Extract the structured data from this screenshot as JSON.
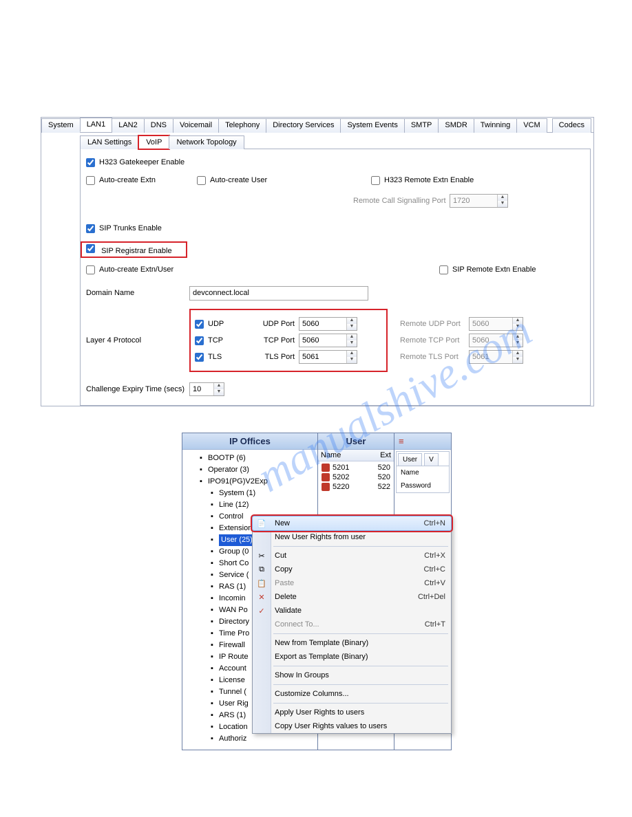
{
  "tabs_outer": [
    "System",
    "LAN1",
    "LAN2",
    "DNS",
    "Voicemail",
    "Telephony",
    "Directory Services",
    "System Events",
    "SMTP",
    "SMDR",
    "Twinning",
    "VCM",
    "Codecs"
  ],
  "tabs_outer_active": "LAN1",
  "tabs_inner": [
    "LAN Settings",
    "VoIP",
    "Network Topology"
  ],
  "tabs_inner_active": "VoIP",
  "form": {
    "h323_gatekeeper": "H323 Gatekeeper Enable",
    "auto_create_extn": "Auto-create Extn",
    "auto_create_user": "Auto-create User",
    "h323_remote": "H323 Remote Extn Enable",
    "remote_call_port_label": "Remote Call Signalling Port",
    "remote_call_port": "1720",
    "sip_trunks": "SIP Trunks Enable",
    "sip_registrar": "SIP Registrar Enable",
    "auto_create_extn_user": "Auto-create Extn/User",
    "sip_remote": "SIP Remote Extn Enable",
    "domain_label": "Domain Name",
    "domain_value": "devconnect.local",
    "layer4_label": "Layer 4 Protocol",
    "udp": "UDP",
    "udp_port_label": "UDP Port",
    "udp_port": "5060",
    "tcp": "TCP",
    "tcp_port_label": "TCP Port",
    "tcp_port": "5060",
    "tls": "TLS",
    "tls_port_label": "TLS Port",
    "tls_port": "5061",
    "remote_udp_label": "Remote UDP Port",
    "remote_udp": "5060",
    "remote_tcp_label": "Remote TCP Port",
    "remote_tcp": "5060",
    "remote_tls_label": "Remote TLS Port",
    "remote_tls": "5061",
    "challenge_label": "Challenge Expiry Time (secs)",
    "challenge_value": "10"
  },
  "panel2": {
    "tree_header": "IP Offices",
    "user_header": "User",
    "tree": [
      {
        "label": "BOOTP (6)",
        "indent": 0
      },
      {
        "label": "Operator (3)",
        "indent": 0
      },
      {
        "label": "IPO91(PG)V2Exp",
        "indent": 0
      },
      {
        "label": "System (1)",
        "indent": 1
      },
      {
        "label": "Line (12)",
        "indent": 1
      },
      {
        "label": "Control",
        "indent": 1
      },
      {
        "label": "Extension",
        "indent": 1
      },
      {
        "label": "User (25)",
        "indent": 1,
        "selected": true
      },
      {
        "label": "Group (0",
        "indent": 1
      },
      {
        "label": "Short Co",
        "indent": 1
      },
      {
        "label": "Service (",
        "indent": 1
      },
      {
        "label": "RAS (1)",
        "indent": 1
      },
      {
        "label": "Incomin",
        "indent": 1
      },
      {
        "label": "WAN Po",
        "indent": 1
      },
      {
        "label": "Directory",
        "indent": 1
      },
      {
        "label": "Time Pro",
        "indent": 1
      },
      {
        "label": "Firewall ",
        "indent": 1
      },
      {
        "label": "IP Route",
        "indent": 1
      },
      {
        "label": "Account",
        "indent": 1
      },
      {
        "label": "License ",
        "indent": 1
      },
      {
        "label": "Tunnel (",
        "indent": 1
      },
      {
        "label": "User Rig",
        "indent": 1
      },
      {
        "label": "ARS (1)",
        "indent": 1
      },
      {
        "label": "Location",
        "indent": 1
      },
      {
        "label": "Authoriz",
        "indent": 1
      }
    ],
    "user_cols": {
      "c1": "Name",
      "c2": "Ext"
    },
    "users": [
      {
        "name": "5201",
        "ext": "520"
      },
      {
        "name": "5202",
        "ext": "520"
      },
      {
        "name": "5220",
        "ext": "522"
      }
    ],
    "right_tab_user": "User",
    "right_tab_v": "V",
    "right_name_label": "Name",
    "right_password_label": "Password"
  },
  "ctx": {
    "new": "New",
    "new_shortcut": "Ctrl+N",
    "new_rights": "New User Rights from user",
    "cut": "Cut",
    "cut_s": "Ctrl+X",
    "copy": "Copy",
    "copy_s": "Ctrl+C",
    "paste": "Paste",
    "paste_s": "Ctrl+V",
    "delete": "Delete",
    "delete_s": "Ctrl+Del",
    "validate": "Validate",
    "connect": "Connect To...",
    "connect_s": "Ctrl+T",
    "newtpl": "New from Template (Binary)",
    "exptpl": "Export as Template (Binary)",
    "showgrp": "Show In Groups",
    "custcol": "Customize Columns...",
    "applyur": "Apply User Rights to users",
    "copyur": "Copy User Rights values to users"
  },
  "watermark": "manualshive.com"
}
